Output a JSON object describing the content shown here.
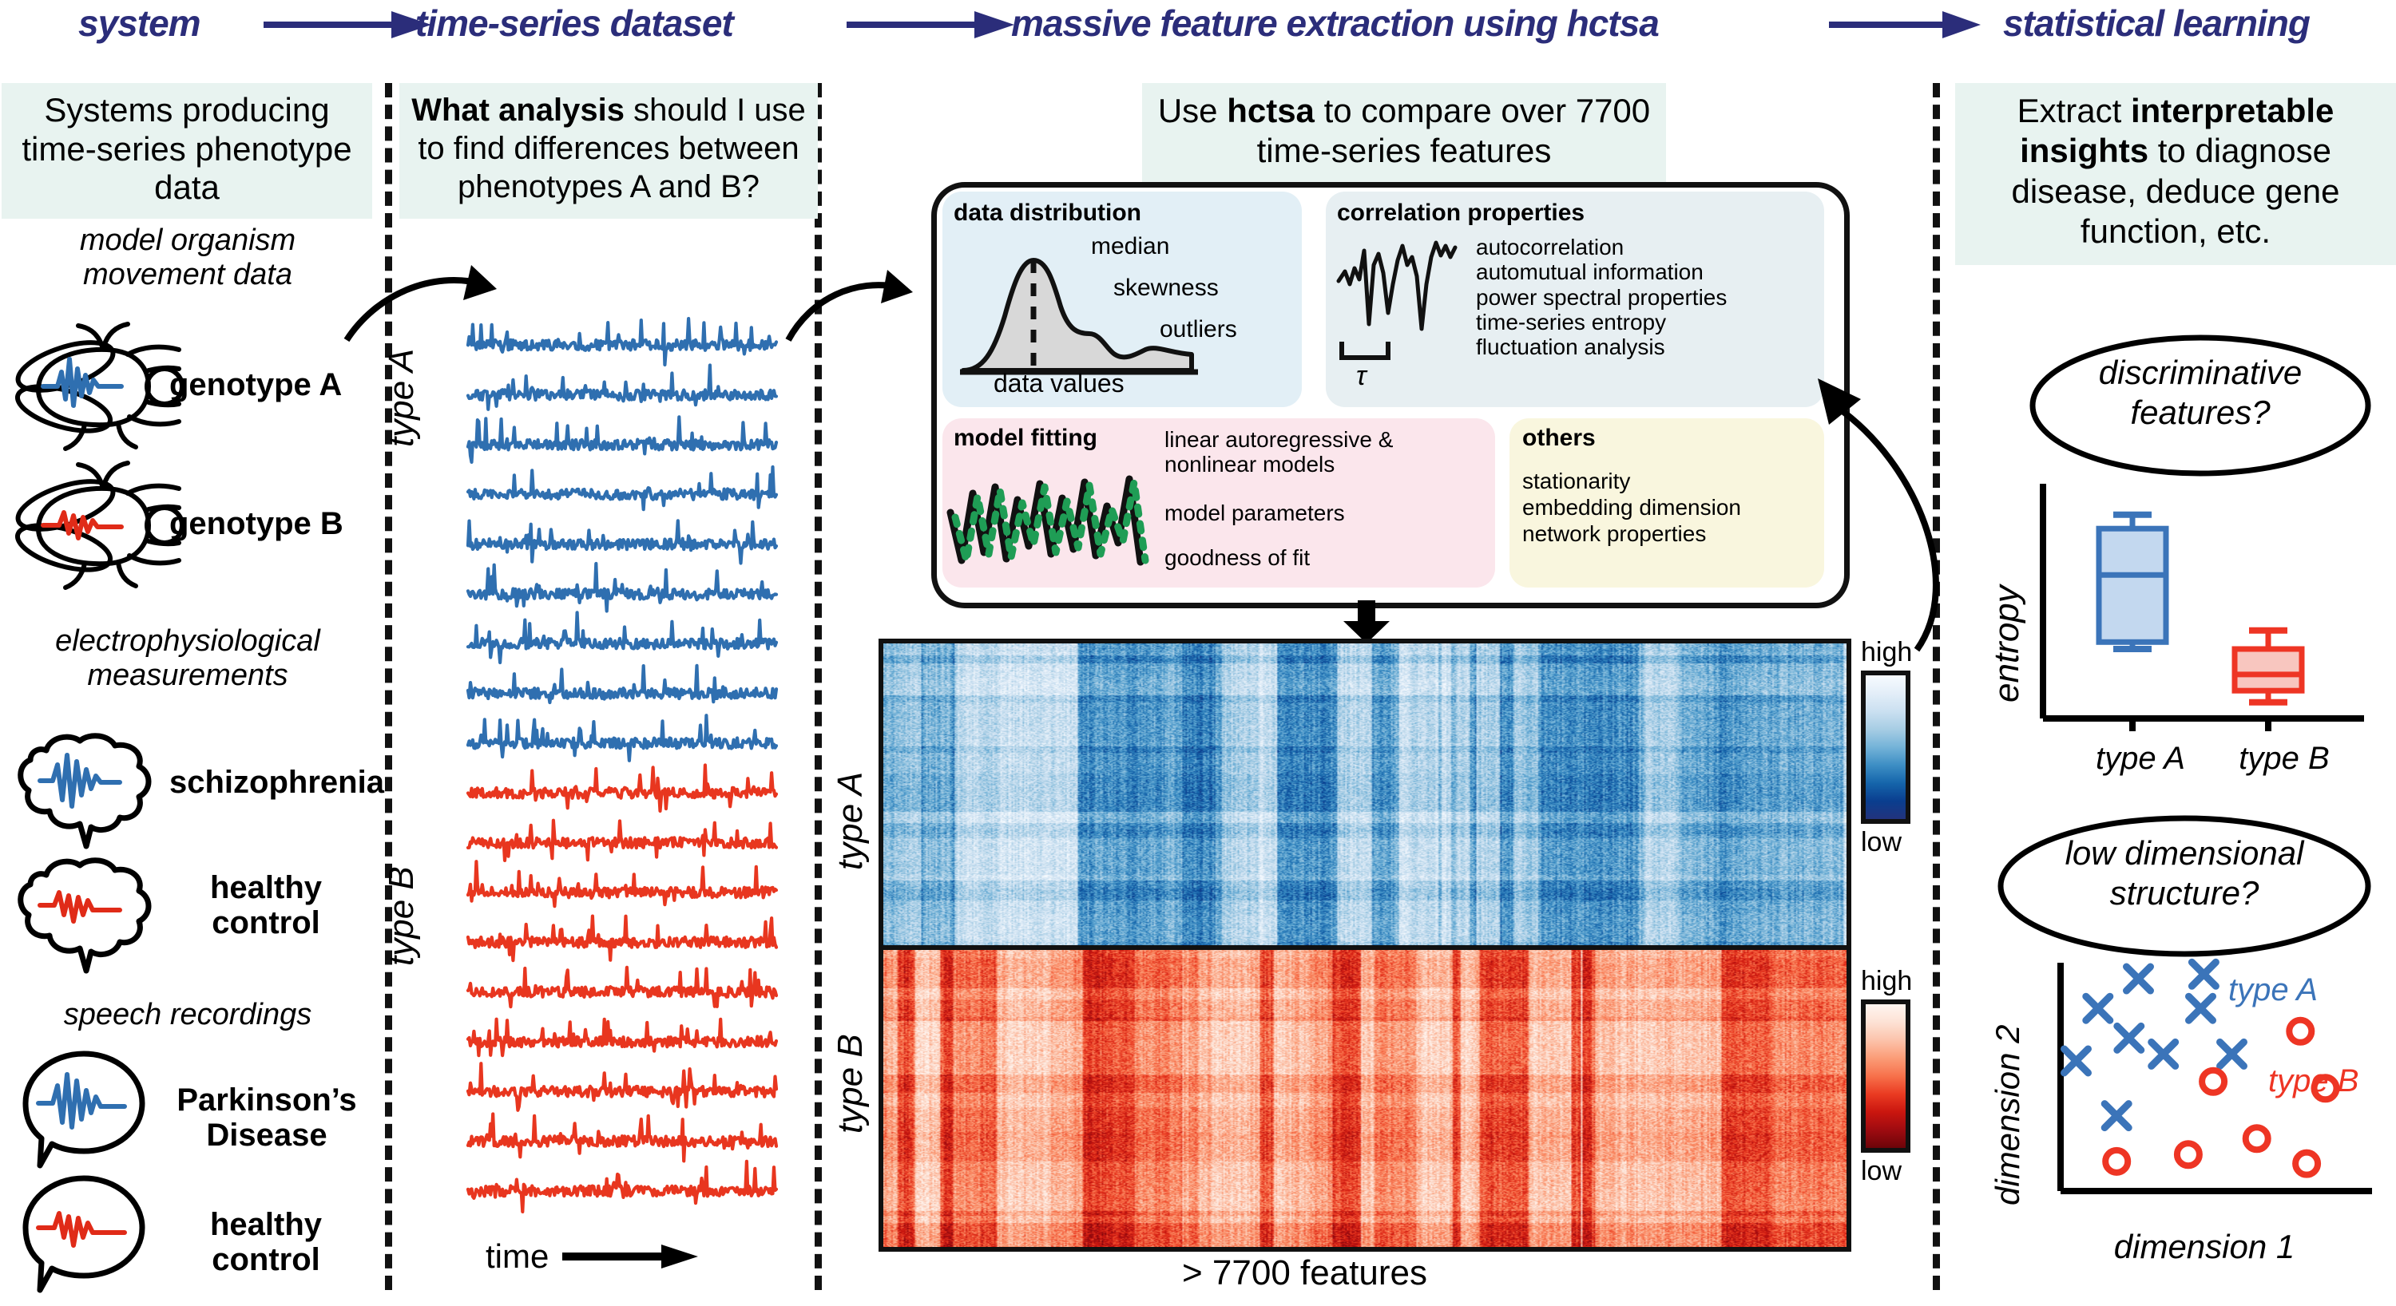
{
  "header": {
    "steps": [
      {
        "label": "system"
      },
      {
        "label": "time-series dataset"
      },
      {
        "label": "massive feature extraction using hctsa"
      },
      {
        "label": "statistical learning"
      }
    ],
    "arrow_icon": "right-arrow-icon"
  },
  "column_system": {
    "callout": "Systems producing time-series phenotype data",
    "groups": [
      {
        "title": "model organism movement data",
        "icon": "fly-icon",
        "entries": [
          {
            "label": "genotype A",
            "color": "#2f6fb0",
            "icon": "fly-icon"
          },
          {
            "label": "genotype B",
            "color": "#e02b18",
            "icon": "fly-icon"
          }
        ]
      },
      {
        "title": "electrophysiological measurements",
        "icon": "brain-icon",
        "entries": [
          {
            "label": "schizophrenia",
            "color": "#2f6fb0",
            "icon": "brain-icon"
          },
          {
            "label": "healthy control",
            "color": "#e02b18",
            "icon": "brain-icon"
          }
        ]
      },
      {
        "title": "speech recordings",
        "icon": "speech-bubble-icon",
        "entries": [
          {
            "label": "Parkinson’s Disease",
            "color": "#2f6fb0",
            "icon": "speech-bubble-icon"
          },
          {
            "label": "healthy control",
            "color": "#e02b18",
            "icon": "speech-bubble-icon"
          }
        ]
      }
    ]
  },
  "column_dataset": {
    "callout_bold": "What analysis",
    "callout_rest": " should I use to find differences between phenotypes A and B?",
    "series_label_a": "type A",
    "series_label_b": "type B",
    "axis_label": "time",
    "axis_arrow_icon": "right-arrow-icon",
    "n_traces_a": 9,
    "n_traces_b": 9,
    "color_a": "#2f6fb0",
    "color_b": "#e8361f"
  },
  "column_features": {
    "callout_pre": "Use ",
    "callout_bold": "hctsa",
    "callout_post": " to compare over 7700 time-series features",
    "feature_boxes": [
      {
        "title": "data distribution",
        "bg": "#e2eff6",
        "plot": "distribution-plot",
        "annotations": [
          "median",
          "skewness",
          "outliers"
        ],
        "axis_label": "data values",
        "items": []
      },
      {
        "title": "correlation properties",
        "bg": "#e7eff2",
        "plot": "autocorrelation-plot",
        "annotations": [
          "τ"
        ],
        "items": [
          "autocorrelation",
          "automutual information",
          "power spectral properties",
          "time-series entropy",
          "fluctuation analysis"
        ]
      },
      {
        "title": "model fitting",
        "bg": "#fbe6ec",
        "plot": "model-fit-plot",
        "annotations": [],
        "items": [
          "linear autoregressive &",
          "nonlinear models",
          "model parameters",
          "goodness of fit"
        ]
      },
      {
        "title": "others",
        "bg": "#f9f6de",
        "plot": "",
        "annotations": [],
        "items": [
          "stationarity",
          "embedding dimension",
          "network properties"
        ]
      }
    ],
    "heatmap": {
      "row_label_a": "type A",
      "row_label_b": "type B",
      "x_axis_label": "> 7700 features",
      "colorbars": [
        {
          "name": "type-a-colorbar",
          "high": "high",
          "low": "low",
          "stops": [
            "#f7fbff",
            "#e3eef8",
            "#cbe0f1",
            "#a7cde4",
            "#74b3d8",
            "#3d8ec4",
            "#1565ab",
            "#0a3e8f",
            "#22337d"
          ]
        },
        {
          "name": "type-b-colorbar",
          "high": "high",
          "low": "low",
          "stops": [
            "#fff5f0",
            "#fde2d5",
            "#fcc3ab",
            "#fb9c77",
            "#f7714b",
            "#ea3b22",
            "#ca160f",
            "#9e0b10",
            "#6d0409"
          ]
        }
      ]
    },
    "down_arrow_icon": "down-arrow-icon"
  },
  "column_learning": {
    "callout_pre": "Extract ",
    "callout_bold": "interpretable insights",
    "callout_post": " to diagnose disease, deduce gene function, etc.",
    "panels": [
      {
        "bubble": "discriminative features?",
        "chart_ref": "boxplot"
      },
      {
        "bubble": "low dimensional structure?",
        "chart_ref": "scatter"
      }
    ]
  },
  "chart_data": [
    {
      "type": "box",
      "title": "discriminative features?",
      "ylabel": "entropy",
      "xlabel": "",
      "categories": [
        "type A",
        "type B"
      ],
      "grid": false,
      "legend": "none",
      "ylim": [
        0,
        1
      ],
      "series": [
        {
          "name": "type A",
          "color": "#3b74b9",
          "fill": "#c3d8ef",
          "whisker_low": 0.3,
          "q1": 0.33,
          "median": 0.62,
          "q3": 0.82,
          "whisker_high": 0.88
        },
        {
          "name": "type B",
          "color": "#ee3524",
          "fill": "#f8c6bf",
          "whisker_low": 0.07,
          "q1": 0.12,
          "median": 0.19,
          "q3": 0.3,
          "whisker_high": 0.38
        }
      ]
    },
    {
      "type": "scatter",
      "title": "low dimensional structure?",
      "xlabel": "dimension 1",
      "ylabel": "dimension 2",
      "grid": false,
      "legend": "inside-right",
      "xlim": [
        0,
        1
      ],
      "ylim": [
        0,
        1
      ],
      "series": [
        {
          "name": "type A",
          "color": "#3b74b9",
          "marker": "x",
          "points": [
            [
              0.25,
              0.93
            ],
            [
              0.46,
              0.95
            ],
            [
              0.12,
              0.8
            ],
            [
              0.45,
              0.8
            ],
            [
              0.22,
              0.67
            ],
            [
              0.33,
              0.6
            ],
            [
              0.05,
              0.57
            ],
            [
              0.55,
              0.6
            ],
            [
              0.18,
              0.33
            ]
          ]
        },
        {
          "name": "type B",
          "color": "#ee3524",
          "marker": "o",
          "points": [
            [
              0.77,
              0.7
            ],
            [
              0.49,
              0.48
            ],
            [
              0.85,
              0.45
            ],
            [
              0.63,
              0.23
            ],
            [
              0.41,
              0.16
            ],
            [
              0.18,
              0.13
            ],
            [
              0.79,
              0.12
            ]
          ]
        }
      ]
    }
  ]
}
